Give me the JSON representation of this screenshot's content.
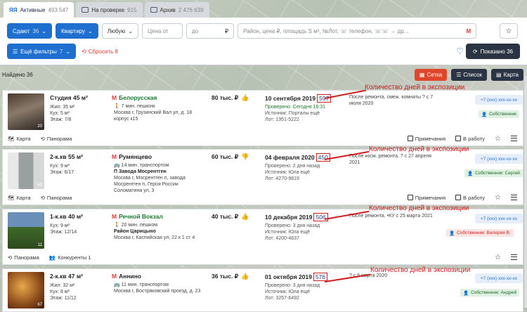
{
  "tabs": [
    {
      "label": "Активные",
      "count": "493 547"
    },
    {
      "label": "На проверке",
      "count": "915"
    },
    {
      "label": "Архив",
      "count": "2 476 639"
    }
  ],
  "filters": {
    "deal": {
      "label": "Сдают",
      "count": "36"
    },
    "type": "Квартиру",
    "term": "Любую",
    "price_from": "Цена от",
    "price_to": "до",
    "currency": "₽",
    "search_placeholder": "Район, цена ₽, площадь S м², №Лот, ☏ телефон, ☏☏ → др...",
    "more": {
      "label": "Ещё фильтры",
      "count": "7"
    },
    "reset": "Сбросить 8",
    "shown": "Показано 36"
  },
  "found": "Найдено 36",
  "views": [
    "Сетка",
    "Список",
    "Карта"
  ],
  "annotation": "Количество дней в экспозиции",
  "listings": [
    {
      "title": "Студия 45 м²",
      "specs": [
        "Жил: 35 м²",
        "Кух: 5 м²",
        "Этаж: 7/8"
      ],
      "photos": "20",
      "metro": "Белорусская",
      "walk": "7 мин. пешком",
      "addr": "Москва г, Грузинский Вал ул, д. 18 корпус к15",
      "price": "80 тыс. ₽",
      "date": "10 сентября 2019",
      "days": "597",
      "meta": [
        "Проверено: Сегодня 16:31",
        "Источник: Порталы ещё",
        "Лот: 1951-5222"
      ],
      "checked_green": true,
      "comment": "После ремонта. смеж. комнаты ? с 7 июля 2020",
      "phone": "+7 (xxx) xxx-xx-xx",
      "owner": "Собственник",
      "owner_color": "green",
      "footer": [
        "Карта",
        "Панорама"
      ],
      "actions": [
        "Примечания",
        "В работу"
      ]
    },
    {
      "title": "2-к.кв 55 м²",
      "specs": [
        "Кух: 9 м²",
        "Этаж: 6/17"
      ],
      "photos": "45",
      "metro": "Румянцево",
      "walk": "14 мин. транспортом",
      "addr_bold": "П Завода Мосрентген",
      "addr": "Москва г, Мосрентген п, завода Мосрентген п, Героя России Соломатина ул, 3",
      "price": "60 тыс. ₽",
      "date": "04 февраля 2020",
      "days": "450",
      "meta": [
        "Проверено: 2 дня назад",
        "Источник: Юла ещё",
        "Лот: 4270-9819"
      ],
      "checked_green": false,
      "comment": "После косм. ремонта, ? с 27 апреля 2021",
      "phone": "+7 (xxx) xxx-xx-xx",
      "owner": "Собственник: Сергей",
      "owner_color": "green",
      "footer": [
        "Карта",
        "Панорама"
      ],
      "actions": [
        "Примечания",
        "В работу"
      ]
    },
    {
      "title": "1-к.кв 40 м²",
      "specs": [
        "Кух: 9 м²",
        "Этаж: 12/14"
      ],
      "photos": "11",
      "metro": "Речной Вокзал",
      "walk": "20 мин. пешком",
      "addr_bold": "Район Царицыно",
      "addr": "Москва г, Каспийская ул, 22 к 1 ст 4",
      "price": "40 тыс. ₽",
      "date": "10 декабря 2019",
      "days": "506",
      "meta": [
        "Проверено: 3 дня назад",
        "Источник: Юла ещё",
        "Лот: 4200-4637"
      ],
      "checked_green": false,
      "comment": "После ремонта. •КУ с 25 марта 2021",
      "phone": "+7 (xxx) xxx-xx-xx",
      "owner": "Собственник: Валерия В.",
      "owner_color": "red",
      "footer": [
        "Панорама",
        "Конкуренты 1"
      ],
      "actions": [
        "Примечания",
        "В работу"
      ]
    },
    {
      "title": "2-к.кв 47 м²",
      "specs": [
        "Жил: 32 м²",
        "Кух: 8 м²",
        "Этаж: 11/12"
      ],
      "photos": "67",
      "metro": "Аннино",
      "walk": "11 мин. транспортом",
      "addr": "Москва г, Востряковский проезд, д. 23",
      "price": "36 тыс. ₽",
      "date": "01 октября 2019",
      "days": "576",
      "meta": [
        "Проверено: 3 дня назад",
        "Источник: Юла ещё",
        "Лот: 3257-6492"
      ],
      "checked_green": false,
      "comment": "? с 6 марта 2020",
      "phone": "+7 (xxx) xxx-xx-xx",
      "owner": "Собственник: Андрей",
      "owner_color": "green",
      "footer": [],
      "actions": []
    }
  ]
}
